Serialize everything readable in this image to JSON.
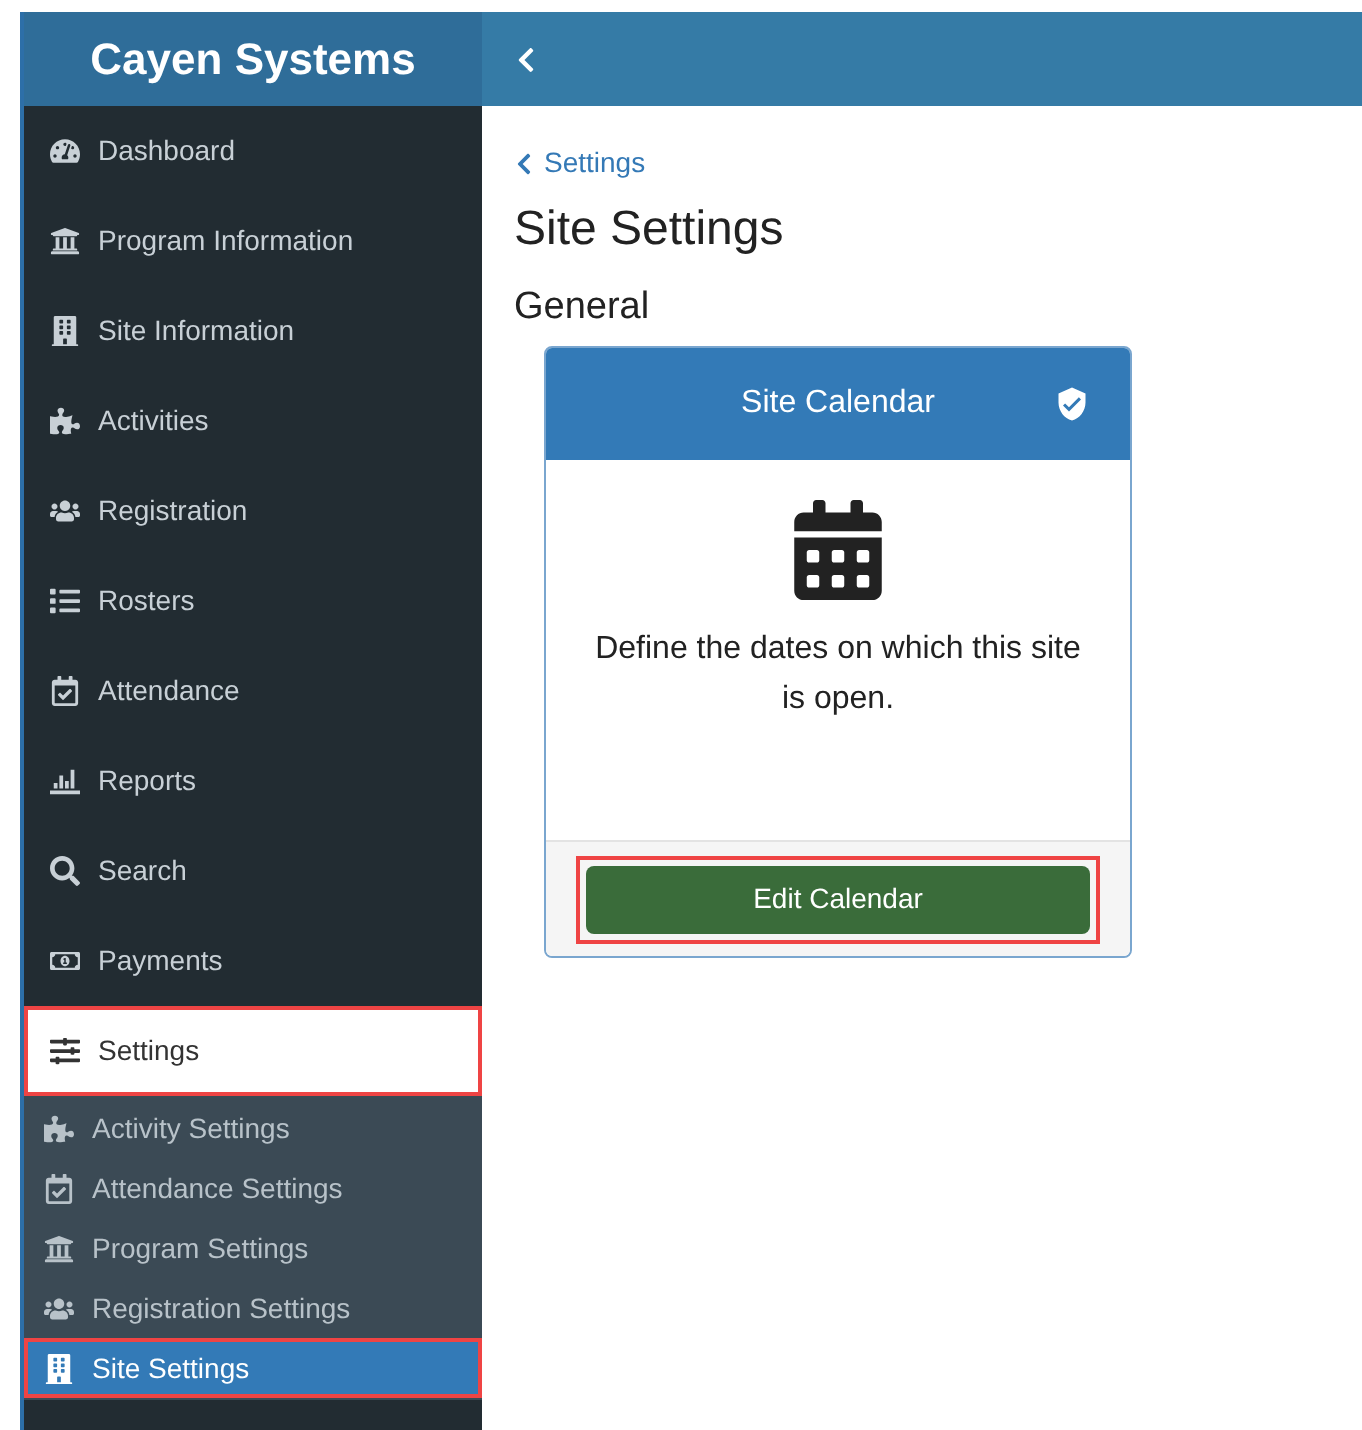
{
  "brand": "Cayen Systems",
  "menu": [
    {
      "label": "Dashboard",
      "selected": false,
      "annotated": false
    },
    {
      "label": "Program Information",
      "selected": false,
      "annotated": false
    },
    {
      "label": "Site Information",
      "selected": false,
      "annotated": false
    },
    {
      "label": "Activities",
      "selected": false,
      "annotated": false
    },
    {
      "label": "Registration",
      "selected": false,
      "annotated": false
    },
    {
      "label": "Rosters",
      "selected": false,
      "annotated": false
    },
    {
      "label": "Attendance",
      "selected": false,
      "annotated": false
    },
    {
      "label": "Reports",
      "selected": false,
      "annotated": false
    },
    {
      "label": "Search",
      "selected": false,
      "annotated": false
    },
    {
      "label": "Payments",
      "selected": false,
      "annotated": false
    },
    {
      "label": "Settings",
      "selected": true,
      "annotated": true,
      "children": [
        {
          "label": "Activity Settings",
          "selected": false,
          "annotated": false
        },
        {
          "label": "Attendance Settings",
          "selected": false,
          "annotated": false
        },
        {
          "label": "Program Settings",
          "selected": false,
          "annotated": false
        },
        {
          "label": "Registration Settings",
          "selected": false,
          "annotated": false
        },
        {
          "label": "Site Settings",
          "selected": true,
          "annotated": true
        }
      ]
    }
  ],
  "breadcrumb": "Settings",
  "page_title": "Site Settings",
  "section_title": "General",
  "card": {
    "title": "Site Calendar",
    "description": "Define the dates on which this site is open.",
    "button": {
      "label": "Edit Calendar",
      "annotated": true
    }
  }
}
